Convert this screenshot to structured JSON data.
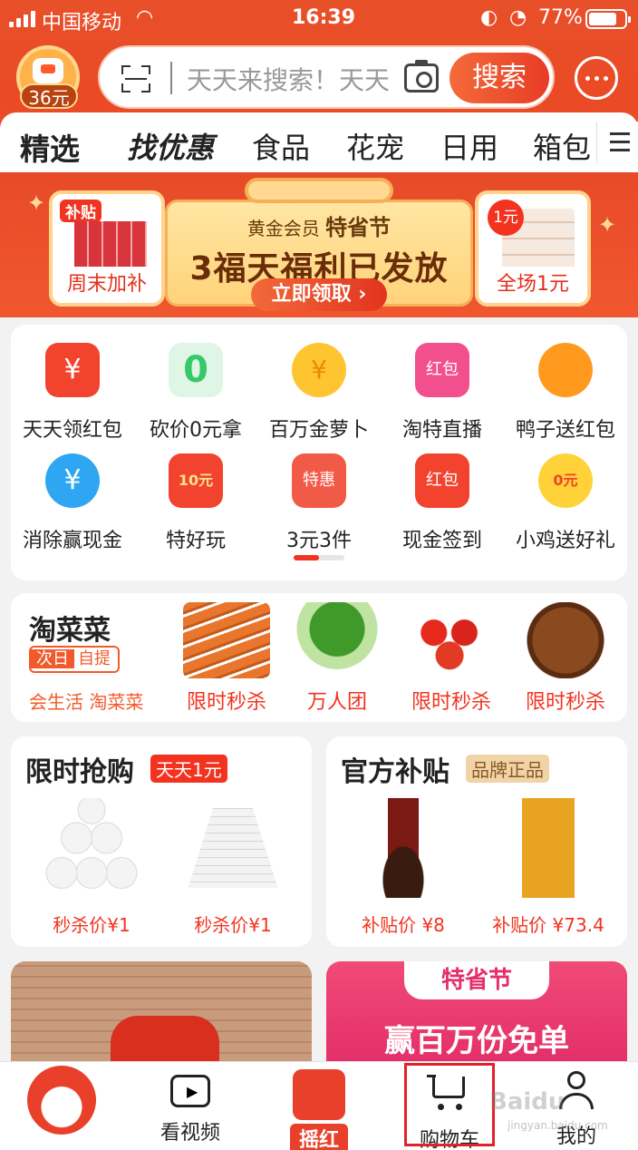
{
  "status_bar": {
    "carrier": "中国移动",
    "time": "16:39",
    "battery": "77%"
  },
  "header": {
    "coin_amount": "36元",
    "search_placeholder": "天天来搜索！天天",
    "search_button": "搜索"
  },
  "tabs": [
    "精选",
    "找优惠",
    "食品",
    "花宠",
    "日用",
    "箱包"
  ],
  "banner": {
    "left_tag": "补贴",
    "left_caption": "周末加补",
    "member_label": "黄金会员",
    "event_label": "特省节",
    "headline": "3福天福利已发放",
    "claim_button": "立即领取",
    "right_badge": "1元",
    "right_caption": "全场1元"
  },
  "grid_items": [
    {
      "label": "天天领红包",
      "icon": "red-envelope-icon",
      "color": "#f2432f"
    },
    {
      "label": "砍价0元拿",
      "icon": "zero-yuan-icon",
      "color": "#37c86a"
    },
    {
      "label": "百万金萝卜",
      "icon": "gold-carrot-icon",
      "color": "#ffc531"
    },
    {
      "label": "淘特直播",
      "icon": "live-stream-icon",
      "color": "#f24f8f"
    },
    {
      "label": "鸭子送红包",
      "icon": "duck-icon",
      "color": "#ff9a1f"
    },
    {
      "label": "消除赢现金",
      "icon": "star-game-icon",
      "color": "#2fa6f2"
    },
    {
      "label": "特好玩",
      "icon": "game-play-icon",
      "color": "#f2432f"
    },
    {
      "label": "3元3件",
      "icon": "shop-sale-icon",
      "color": "#f25a48"
    },
    {
      "label": "现金签到",
      "icon": "calendar-icon",
      "color": "#f2432f"
    },
    {
      "label": "小鸡送好礼",
      "icon": "chick-icon",
      "color": "#ffd23a"
    }
  ],
  "grid_labels": {
    "s0": "红包",
    "s1": "10元",
    "s2": "特惠",
    "s3": "红包",
    "s4": "0元"
  },
  "taocaicai": {
    "title": "淘菜菜",
    "badge_prefix": "次日",
    "badge_text": "自提",
    "slogan": "会生活 淘菜菜",
    "products": [
      {
        "label": "限时秒杀",
        "item": "carrot"
      },
      {
        "label": "万人团",
        "item": "bok-choy"
      },
      {
        "label": "限时秒杀",
        "item": "tomato"
      },
      {
        "label": "限时秒杀",
        "item": "chestnut"
      }
    ]
  },
  "flash_sale": {
    "title": "限时抢购",
    "tag": "天天1元",
    "items": [
      {
        "price": "秒杀价¥1"
      },
      {
        "price": "秒杀价¥1"
      }
    ]
  },
  "subsidy": {
    "title": "官方补贴",
    "tag": "品牌正品",
    "items": [
      {
        "price": "补贴价 ¥8"
      },
      {
        "price": "补贴价 ¥73.4"
      }
    ]
  },
  "promo_right": {
    "tag": "特省节",
    "title": "赢百万份免单"
  },
  "tabbar": [
    {
      "label": "",
      "icon": "rabbit-avatar-icon"
    },
    {
      "label": "看视频",
      "icon": "video-icon"
    },
    {
      "label": "摇红包",
      "icon": "shake-red-envelope-icon"
    },
    {
      "label": "购物车",
      "icon": "cart-icon"
    },
    {
      "label": "我的",
      "icon": "profile-icon"
    }
  ],
  "watermark": {
    "brand": "Baidu",
    "site": "jingyan.baidu.com"
  }
}
